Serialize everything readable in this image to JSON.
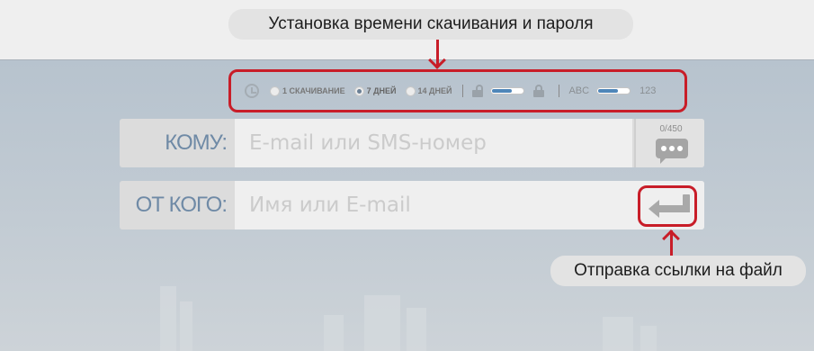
{
  "callouts": {
    "top": "Установка времени скачивания и пароля",
    "bottom": "Отправка ссылки на файл"
  },
  "options": {
    "clock_icon": "clock-icon",
    "items": [
      {
        "label": "1 СКАЧИВАНИЕ",
        "selected": false
      },
      {
        "label": "7 ДНЕЙ",
        "selected": true
      },
      {
        "label": "14 ДНЕЙ",
        "selected": false
      }
    ],
    "password_slider_level": 0.6,
    "alphabet_label": "ABC",
    "numeric_label": "123",
    "charset_slider_level": 0.6
  },
  "to_row": {
    "label": "КОМУ:",
    "placeholder": "E-mail или SMS-номер",
    "counter": "0/450",
    "icon": "sms-bubble-icon"
  },
  "from_row": {
    "label": "ОТ КОГО:",
    "placeholder": "Имя или E-mail",
    "icon": "send-arrow-icon"
  },
  "colors": {
    "annotation": "#c81d28",
    "accent": "#4f86b9",
    "label": "#6f8aa6"
  }
}
